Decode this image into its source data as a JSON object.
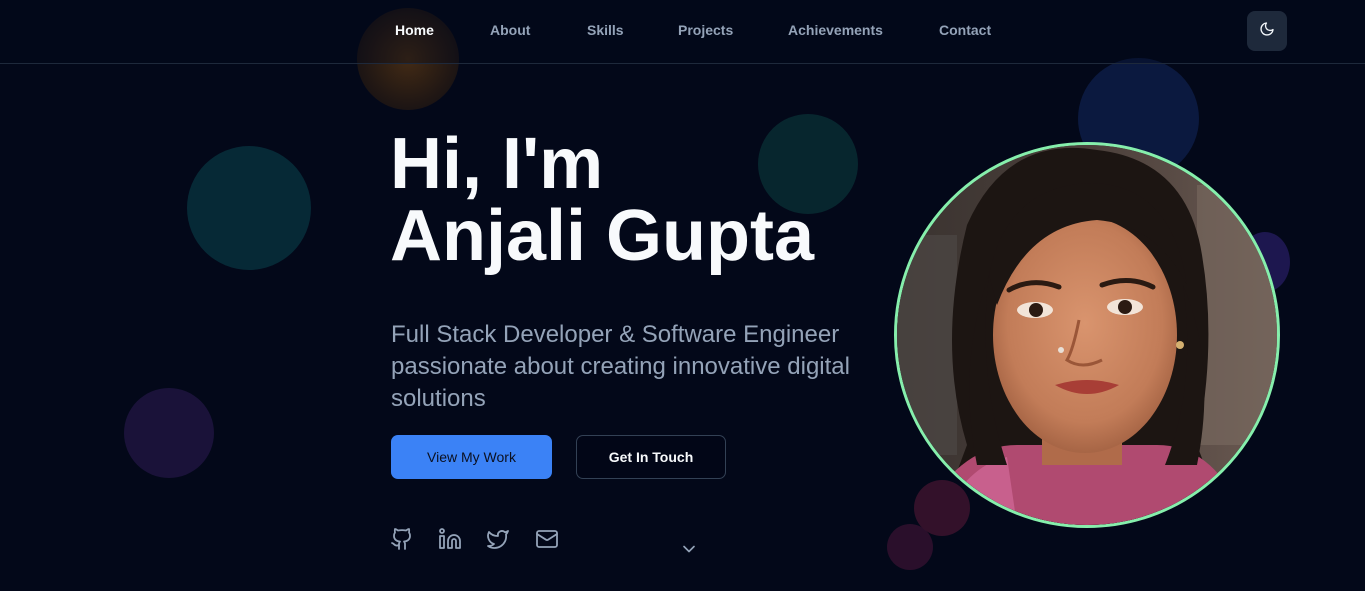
{
  "nav": {
    "items": [
      "Home",
      "About",
      "Skills",
      "Projects",
      "Achievements",
      "Contact"
    ],
    "active": "Home",
    "theme_toggle_icon": "moon-icon"
  },
  "hero": {
    "title_line1": "Hi, I'm",
    "title_line2": "Anjali Gupta",
    "subtitle": "Full Stack Developer & Software Engineer passionate about creating innovative digital solutions",
    "primary_button": "View My Work",
    "secondary_button": "Get In Touch",
    "socials": [
      "github-icon",
      "linkedin-icon",
      "twitter-icon",
      "mail-icon"
    ],
    "scroll_icon": "chevron-down-icon"
  },
  "colors": {
    "background": "#030819",
    "accent": "#3b82f6",
    "avatar_ring": "#86efac",
    "muted_text": "#94a3b8"
  }
}
